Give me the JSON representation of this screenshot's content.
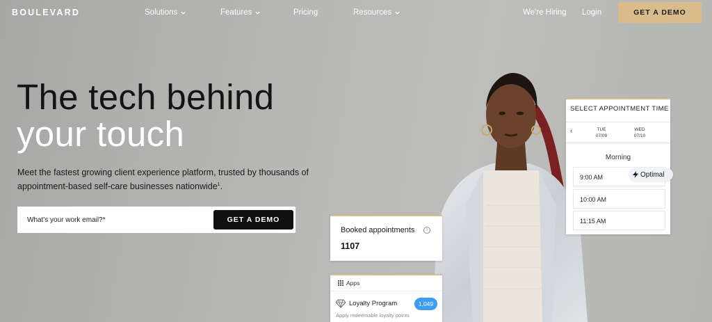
{
  "nav": {
    "logo": "BOULEVARD",
    "items": [
      {
        "label": "Solutions",
        "dropdown": true
      },
      {
        "label": "Features",
        "dropdown": true
      },
      {
        "label": "Pricing",
        "dropdown": false
      },
      {
        "label": "Resources",
        "dropdown": true
      }
    ],
    "hiring": "We're Hiring",
    "login": "Login",
    "demo": "GET A DEMO"
  },
  "hero": {
    "line1": "The tech behind",
    "line2": "your touch",
    "subtitle": "Meet the fastest growing client experience platform, trusted by thousands of appointment-based self-care businesses nationwide",
    "footnote": "1",
    "email_placeholder": "What's your work email?*",
    "cta": "GET A DEMO"
  },
  "appointment_card": {
    "title": "SELECT APPOINTMENT TIME",
    "days": [
      {
        "dow": "TUE",
        "date": "07/09"
      },
      {
        "dow": "WED",
        "date": "07/10"
      }
    ],
    "period": "Morning",
    "slots": [
      "9:00 AM",
      "10:00 AM",
      "11:15 AM"
    ],
    "optimal_label": "Optimal"
  },
  "booked_card": {
    "label": "Booked appointments",
    "value": "1107"
  },
  "apps_card": {
    "header": "Apps",
    "app_name": "Loyalty Program",
    "count": "1,049",
    "description": "Apply redeemable loyalty points"
  },
  "colors": {
    "accent_gold": "#d9bb8c",
    "badge_blue": "#3d9df0",
    "dark": "#101010"
  }
}
